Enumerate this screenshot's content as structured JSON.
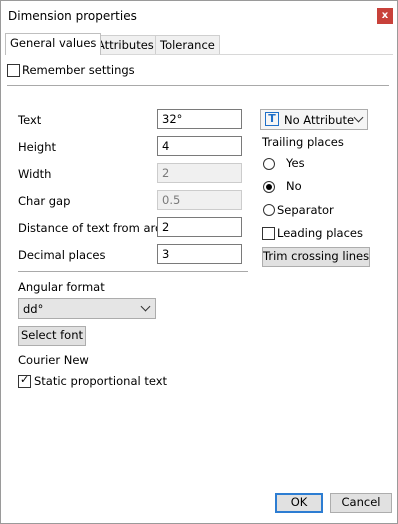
{
  "window": {
    "title": "Dimension properties",
    "close_glyph": "x"
  },
  "tabs": [
    {
      "label": "General values",
      "active": true
    },
    {
      "label": "Attributes",
      "active": false
    },
    {
      "label": "Tolerance",
      "active": false
    }
  ],
  "remember_settings": {
    "label": "Remember settings",
    "checked": false
  },
  "fields": {
    "text": {
      "label": "Text",
      "value": "32°"
    },
    "height": {
      "label": "Height",
      "value": "4"
    },
    "width": {
      "label": "Width",
      "value": "2",
      "disabled": true
    },
    "char_gap": {
      "label": "Char gap",
      "value": "0.5",
      "disabled": true
    },
    "distance": {
      "label": "Distance of text from arc",
      "value": "2"
    },
    "decimal_places": {
      "label": "Decimal places",
      "value": "3"
    }
  },
  "attribute_dropdown": {
    "icon": "text-T-icon",
    "value": "No Attribute"
  },
  "trailing_places": {
    "label": "Trailing places",
    "options": [
      {
        "label": "Yes",
        "selected": false
      },
      {
        "label": "No",
        "selected": true
      },
      {
        "label": "Separator",
        "selected": false
      }
    ]
  },
  "leading_places": {
    "label": "Leading places",
    "checked": false
  },
  "trim_button": "Trim crossing lines",
  "angular_format": {
    "label": "Angular format",
    "value": "dd°"
  },
  "select_font_button": "Select font",
  "font_name": "Courier New",
  "static_proportional": {
    "label": "Static proportional text",
    "checked": true
  },
  "buttons": {
    "ok": "OK",
    "cancel": "Cancel"
  },
  "colors": {
    "close_button": "#c8413a",
    "ok_border": "#2d7dd2",
    "text_icon": "#1e6fc8"
  }
}
